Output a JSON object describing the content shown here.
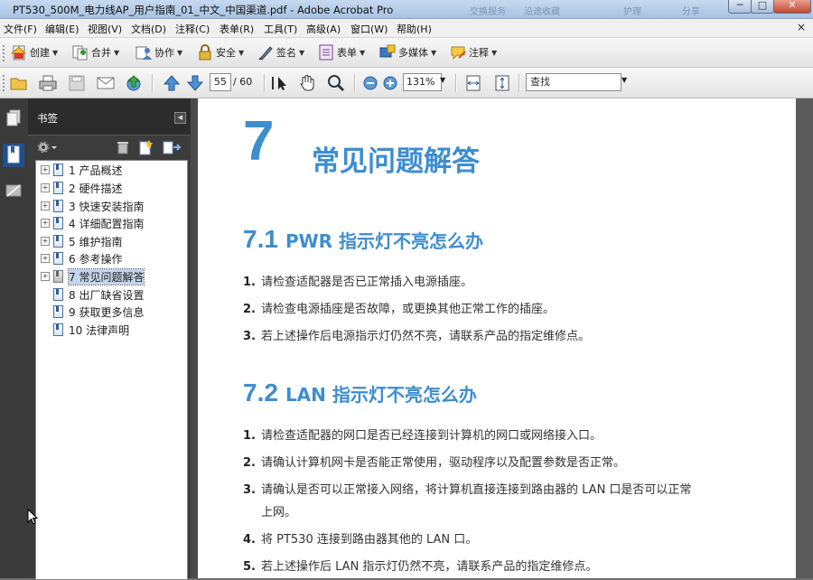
{
  "window": {
    "title": "PT530_500M_电力线AP_用户指南_01_中文_中国渠道.pdf - Adobe Acrobat Pro",
    "ghost_text_1": "交换服务",
    "ghost_text_2": "沿途收藏",
    "ghost_text_3": "护理",
    "ghost_text_4": "分享",
    "min_label": "─",
    "max_label": "□",
    "close_label": "✕"
  },
  "menu": {
    "items": [
      "文件(F)",
      "编辑(E)",
      "视图(V)",
      "文档(D)",
      "注释(C)",
      "表单(R)",
      "工具(T)",
      "高级(A)",
      "窗口(W)",
      "帮助(H)"
    ],
    "close": "×"
  },
  "toolbar1": {
    "create": "创建",
    "combine": "合并",
    "collaborate": "协作",
    "secure": "安全",
    "sign": "签名",
    "forms": "表单",
    "multimedia": "多媒体",
    "comment": "注释"
  },
  "toolbar2": {
    "current_page": "55",
    "total_pages": "/ 60",
    "zoom": "131%",
    "find_placeholder": "查找"
  },
  "bookmarks_panel": {
    "title": "书签",
    "items": [
      {
        "label": "1 产品概述",
        "expandable": true
      },
      {
        "label": "2 硬件描述",
        "expandable": true
      },
      {
        "label": "3 快速安装指南",
        "expandable": true
      },
      {
        "label": "4 详细配置指南",
        "expandable": true
      },
      {
        "label": "5 维护指南",
        "expandable": true
      },
      {
        "label": "6 参考操作",
        "expandable": true
      },
      {
        "label": "7 常见问题解答",
        "expandable": true,
        "selected": true
      },
      {
        "label": "8 出厂缺省设置",
        "expandable": false
      },
      {
        "label": "9 获取更多信息",
        "expandable": false
      },
      {
        "label": "10 法律声明",
        "expandable": false
      }
    ]
  },
  "document": {
    "chapter_number": "7",
    "chapter_title": "常见问题解答",
    "section1": {
      "number": "7.1",
      "title": "PWR 指示灯不亮怎么办",
      "items": [
        "请检查适配器是否已正常插入电源插座。",
        "请检查电源插座是否故障，或更换其他正常工作的插座。",
        "若上述操作后电源指示灯仍然不亮，请联系产品的指定维修点。"
      ]
    },
    "section2": {
      "number": "7.2",
      "title": "LAN 指示灯不亮怎么办",
      "items": [
        "请检查适配器的网口是否已经连接到计算机的网口或网络接入口。",
        "请确认计算机网卡是否能正常使用，驱动程序以及配置参数是否正常。",
        "请确认是否可以正常接入网络，将计算机直接连接到路由器的 LAN 口是否可以正常",
        "将 PT530 连接到路由器其他的 LAN 口。",
        "若上述操作后 LAN 指示灯仍然不亮，请联系产品的指定维修点。"
      ],
      "item3_continuation": "上网。"
    },
    "accent_color": "#3e8ecf"
  }
}
